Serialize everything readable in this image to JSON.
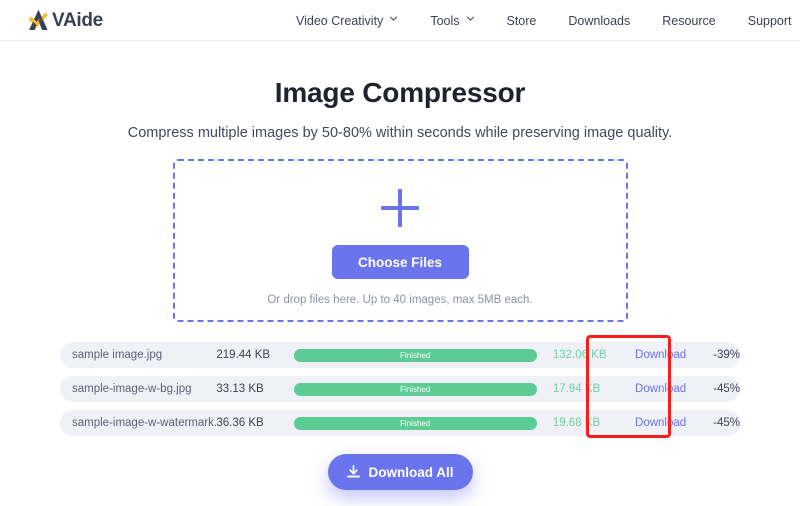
{
  "header": {
    "brand": {
      "name": "VAide",
      "logo_icon": "vaide-logo-icon"
    },
    "nav": [
      {
        "label": "Video Creativity",
        "has_dropdown": true,
        "icon": "chevron-down-icon"
      },
      {
        "label": "Tools",
        "has_dropdown": true,
        "icon": "chevron-down-icon"
      },
      {
        "label": "Store",
        "has_dropdown": false
      },
      {
        "label": "Downloads",
        "has_dropdown": false
      },
      {
        "label": "Resource",
        "has_dropdown": false
      },
      {
        "label": "Support",
        "has_dropdown": false
      }
    ]
  },
  "hero": {
    "title": "Image Compressor",
    "subtitle": "Compress multiple images by 50-80% within seconds while preserving image quality."
  },
  "dropzone": {
    "plus_icon": "plus-icon",
    "choose_files_label": "Choose Files",
    "hint": "Or drop files here. Up to 40 images, max 5MB each."
  },
  "files": {
    "download_label": "Download",
    "status_label": "Finished",
    "rows": [
      {
        "name": "sample image.jpg",
        "original_size": "219.44 KB",
        "status": "Finished",
        "compressed_size": "132.06 KB",
        "download": "Download",
        "reduction": "-39%"
      },
      {
        "name": "sample-image-w-bg.jpg",
        "original_size": "33.13 KB",
        "status": "Finished",
        "compressed_size": "17.94 KB",
        "download": "Download",
        "reduction": "-45%"
      },
      {
        "name": "sample-image-w-watermark.jpg",
        "original_size": "36.36 KB",
        "status": "Finished",
        "compressed_size": "19.68 KB",
        "download": "Download",
        "reduction": "-45%"
      }
    ]
  },
  "actions": {
    "download_all_label": "Download All",
    "download_all_icon": "download-icon"
  },
  "annotation": {
    "type": "highlight-rectangle",
    "color": "#fb1c1c",
    "target": "download-column"
  },
  "colors": {
    "accent_purple": "#6b74ec",
    "progress_green": "#5dcb94",
    "compressed_text_green": "#72cfa0",
    "row_background": "#eff1f7",
    "annotation_red": "#fb1c1c",
    "logo_gold": "#f5c134",
    "logo_navy": "#3b3f55"
  }
}
